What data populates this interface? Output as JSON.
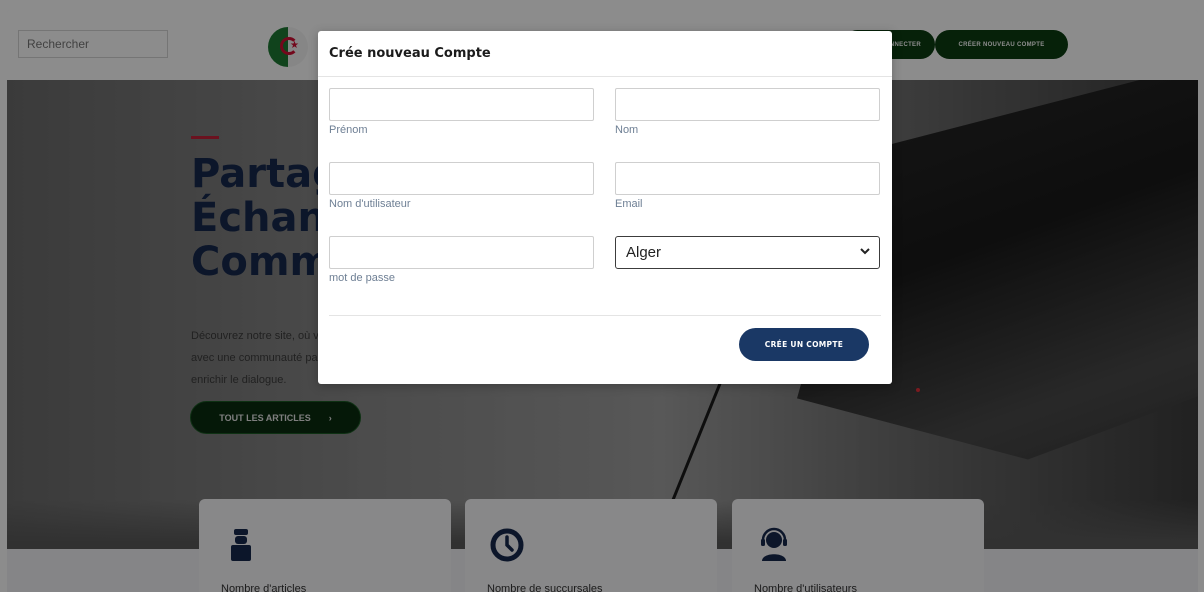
{
  "header": {
    "search_placeholder": "Rechercher",
    "login_label": "SE CONNECTER",
    "register_label": "CRÉER NOUVEAU COMPTE"
  },
  "hero": {
    "title_line1": "Partager,",
    "title_line2": "Échanger,",
    "title_line3": "Communiquer",
    "description_line1": "Découvrez notre site, où vous pouvez partager vos idées",
    "description_line2": "avec une communauté passionnée et contribuer à",
    "description_line3": "enrichir le dialogue.",
    "cta_label": "TOUT LES ARTICLES",
    "cta_arrow": "›"
  },
  "stats": [
    {
      "label": "Nombre d'articles",
      "icon": "agent-icon"
    },
    {
      "label": "Nombre de succursales",
      "icon": "clock-icon"
    },
    {
      "label": "Nombre d'utilisateurs",
      "icon": "headset-user-icon"
    }
  ],
  "modal": {
    "title": "Crée nouveau Compte",
    "fields": {
      "prenom": {
        "label": "Prénom",
        "value": ""
      },
      "nom": {
        "label": "Nom",
        "value": ""
      },
      "username": {
        "label": "Nom d'utilisateur",
        "value": ""
      },
      "email": {
        "label": "Email",
        "value": ""
      },
      "password": {
        "label": "mot de passe",
        "value": ""
      },
      "wilaya": {
        "selected": "Alger"
      }
    },
    "submit_label": "CRÉE UN COMPTE"
  },
  "colors": {
    "primary_navy": "#1a3865",
    "dark_green": "#0b3d12",
    "accent_red": "#c4213a",
    "label_gray": "#6e7f94"
  }
}
